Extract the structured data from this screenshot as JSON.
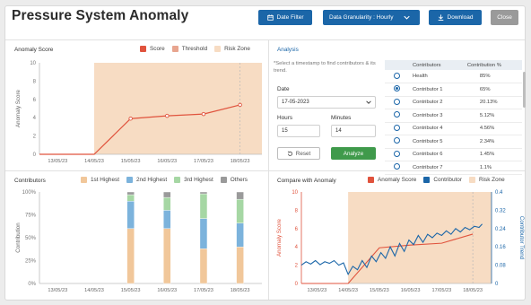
{
  "header": {
    "title": "Pressure System Anomaly",
    "date_filter": "Date Filter",
    "granularity": "Data Granularity : Hourly",
    "download": "Download",
    "close": "Close"
  },
  "anomaly_panel": {
    "title": "Anomaly Score",
    "legend": [
      "Score",
      "Threshold",
      "Risk Zone"
    ]
  },
  "analysis": {
    "tab": "Analysis",
    "hint": "*Select a timestamp to find contributors & its trend.",
    "date_label": "Date",
    "date_value": "17-05-2023",
    "hours_label": "Hours",
    "hours_value": "15",
    "minutes_label": "Minutes",
    "minutes_value": "14",
    "reset": "Reset",
    "analyze": "Analyze",
    "table_headers": [
      "Contributors",
      "Contribution %"
    ],
    "rows": [
      {
        "name": "Health",
        "pct": "85%"
      },
      {
        "name": "Contributor 1",
        "pct": "65%"
      },
      {
        "name": "Contributor 2",
        "pct": "20.13%"
      },
      {
        "name": "Contributor 3",
        "pct": "5.12%"
      },
      {
        "name": "Contributor 4",
        "pct": "4.56%"
      },
      {
        "name": "Contributor 5",
        "pct": "2.34%"
      },
      {
        "name": "Contributor 6",
        "pct": "1.45%"
      },
      {
        "name": "Contributor 7",
        "pct": "1.1%"
      }
    ]
  },
  "contributors_panel": {
    "title": "Contributors",
    "legend": [
      "1st Highest",
      "2nd Highest",
      "3rd Highest",
      "Others"
    ]
  },
  "compare_panel": {
    "title": "Compare with Anomaly",
    "legend": [
      "Anomaly Score",
      "Contributor",
      "Risk Zone"
    ]
  },
  "colors": {
    "score": "#e0533d",
    "threshold": "#e8a58f",
    "risk_zone": "#f7dcc3",
    "first": "#f1c79a",
    "second": "#7cb3dc",
    "third": "#a6d7a4",
    "others": "#9a9a9a",
    "contributor": "#1b66a8",
    "accent": "#1b66a8",
    "analyze": "#3f9a4b"
  },
  "chart_data": [
    {
      "type": "line",
      "title": "Anomaly Score",
      "ylabel": "Anomaly Score",
      "x": [
        "13/05/23",
        "14/05/23",
        "15/05/23",
        "16/05/23",
        "17/05/23",
        "18/05/23"
      ],
      "ylim": [
        0,
        10
      ],
      "yticks": [
        0,
        2,
        4,
        6,
        8,
        10
      ],
      "series": [
        {
          "name": "Score",
          "points": [
            [
              12.5,
              0
            ],
            [
              14.0,
              0
            ],
            [
              15.0,
              3.9
            ],
            [
              16.0,
              4.2
            ],
            [
              17.0,
              4.4
            ],
            [
              18.0,
              5.4
            ]
          ]
        }
      ],
      "risk_zone": [
        14.0,
        19.0
      ]
    },
    {
      "type": "bar",
      "title": "Contributors",
      "ylabel": "Contribution",
      "x": [
        "13/05/23",
        "14/05/23",
        "15/05/23",
        "16/05/23",
        "17/05/23",
        "18/05/23"
      ],
      "yticks": [
        "0%",
        "25%",
        "50%",
        "75%",
        "100%"
      ],
      "stacked": true,
      "bars": [
        {
          "date": "15/05/23",
          "first": 60,
          "second": 30,
          "third": 7,
          "others": 3
        },
        {
          "date": "16/05/23",
          "first": 60,
          "second": 20,
          "third": 14,
          "others": 6
        },
        {
          "date": "17/05/23",
          "first": 38,
          "second": 33,
          "third": 27,
          "others": 2
        },
        {
          "date": "18/05/23",
          "first": 40,
          "second": 26,
          "third": 26,
          "others": 8
        }
      ]
    },
    {
      "type": "line",
      "title": "Compare with Anomaly",
      "ylabel": "Anomaly Score",
      "y2label": "Contributor Trend",
      "x": [
        "13/05/23",
        "14/05/23",
        "15/05/23",
        "16/05/23",
        "17/05/23",
        "18/05/23"
      ],
      "ylim": [
        0,
        10
      ],
      "yticks": [
        0,
        2,
        4,
        6,
        8,
        10
      ],
      "y2ticks": [
        0,
        0.08,
        0.16,
        0.24,
        0.32,
        0.4
      ],
      "risk_zone": [
        14.0,
        19.0
      ],
      "series": [
        {
          "name": "Anomaly Score",
          "points": [
            [
              12.5,
              0
            ],
            [
              14.0,
              0
            ],
            [
              15.0,
              3.9
            ],
            [
              16.0,
              4.2
            ],
            [
              17.0,
              4.4
            ],
            [
              18.0,
              5.4
            ]
          ]
        },
        {
          "name": "Contributor",
          "points": [
            [
              12.5,
              0.08
            ],
            [
              12.65,
              0.095
            ],
            [
              12.8,
              0.085
            ],
            [
              12.95,
              0.1
            ],
            [
              13.1,
              0.082
            ],
            [
              13.25,
              0.095
            ],
            [
              13.4,
              0.088
            ],
            [
              13.55,
              0.1
            ],
            [
              13.7,
              0.08
            ],
            [
              13.85,
              0.09
            ],
            [
              14.0,
              0.04
            ],
            [
              14.15,
              0.075
            ],
            [
              14.3,
              0.06
            ],
            [
              14.45,
              0.1
            ],
            [
              14.6,
              0.07
            ],
            [
              14.75,
              0.12
            ],
            [
              14.9,
              0.095
            ],
            [
              15.05,
              0.135
            ],
            [
              15.2,
              0.11
            ],
            [
              15.35,
              0.16
            ],
            [
              15.5,
              0.12
            ],
            [
              15.65,
              0.175
            ],
            [
              15.8,
              0.14
            ],
            [
              15.95,
              0.19
            ],
            [
              16.1,
              0.17
            ],
            [
              16.25,
              0.21
            ],
            [
              16.4,
              0.18
            ],
            [
              16.55,
              0.215
            ],
            [
              16.7,
              0.2
            ],
            [
              16.85,
              0.22
            ],
            [
              17.0,
              0.21
            ],
            [
              17.15,
              0.23
            ],
            [
              17.3,
              0.215
            ],
            [
              17.45,
              0.24
            ],
            [
              17.6,
              0.225
            ],
            [
              17.75,
              0.245
            ],
            [
              17.9,
              0.235
            ],
            [
              18.05,
              0.25
            ],
            [
              18.2,
              0.245
            ],
            [
              18.3,
              0.26
            ]
          ]
        }
      ]
    }
  ]
}
